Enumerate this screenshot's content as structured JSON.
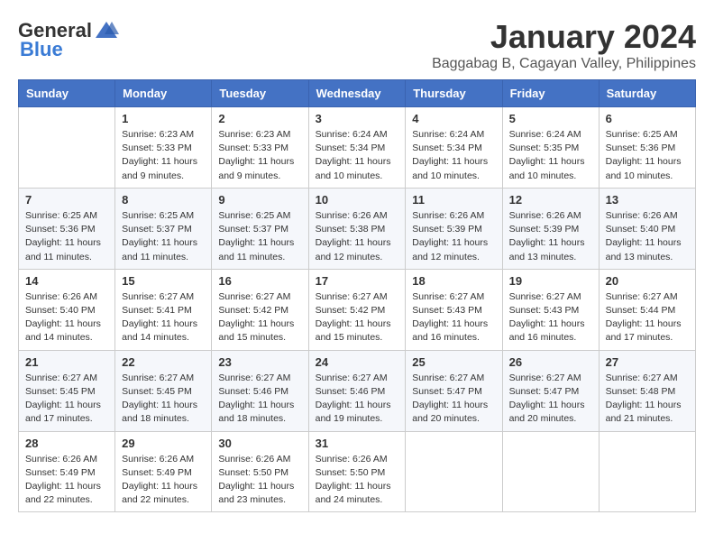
{
  "logo": {
    "general": "General",
    "blue": "Blue"
  },
  "header": {
    "month": "January 2024",
    "location": "Baggabag B, Cagayan Valley, Philippines"
  },
  "days_of_week": [
    "Sunday",
    "Monday",
    "Tuesday",
    "Wednesday",
    "Thursday",
    "Friday",
    "Saturday"
  ],
  "weeks": [
    [
      {
        "day": "",
        "sunrise": "",
        "sunset": "",
        "daylight": ""
      },
      {
        "day": "1",
        "sunrise": "Sunrise: 6:23 AM",
        "sunset": "Sunset: 5:33 PM",
        "daylight": "Daylight: 11 hours and 9 minutes."
      },
      {
        "day": "2",
        "sunrise": "Sunrise: 6:23 AM",
        "sunset": "Sunset: 5:33 PM",
        "daylight": "Daylight: 11 hours and 9 minutes."
      },
      {
        "day": "3",
        "sunrise": "Sunrise: 6:24 AM",
        "sunset": "Sunset: 5:34 PM",
        "daylight": "Daylight: 11 hours and 10 minutes."
      },
      {
        "day": "4",
        "sunrise": "Sunrise: 6:24 AM",
        "sunset": "Sunset: 5:34 PM",
        "daylight": "Daylight: 11 hours and 10 minutes."
      },
      {
        "day": "5",
        "sunrise": "Sunrise: 6:24 AM",
        "sunset": "Sunset: 5:35 PM",
        "daylight": "Daylight: 11 hours and 10 minutes."
      },
      {
        "day": "6",
        "sunrise": "Sunrise: 6:25 AM",
        "sunset": "Sunset: 5:36 PM",
        "daylight": "Daylight: 11 hours and 10 minutes."
      }
    ],
    [
      {
        "day": "7",
        "sunrise": "Sunrise: 6:25 AM",
        "sunset": "Sunset: 5:36 PM",
        "daylight": "Daylight: 11 hours and 11 minutes."
      },
      {
        "day": "8",
        "sunrise": "Sunrise: 6:25 AM",
        "sunset": "Sunset: 5:37 PM",
        "daylight": "Daylight: 11 hours and 11 minutes."
      },
      {
        "day": "9",
        "sunrise": "Sunrise: 6:25 AM",
        "sunset": "Sunset: 5:37 PM",
        "daylight": "Daylight: 11 hours and 11 minutes."
      },
      {
        "day": "10",
        "sunrise": "Sunrise: 6:26 AM",
        "sunset": "Sunset: 5:38 PM",
        "daylight": "Daylight: 11 hours and 12 minutes."
      },
      {
        "day": "11",
        "sunrise": "Sunrise: 6:26 AM",
        "sunset": "Sunset: 5:39 PM",
        "daylight": "Daylight: 11 hours and 12 minutes."
      },
      {
        "day": "12",
        "sunrise": "Sunrise: 6:26 AM",
        "sunset": "Sunset: 5:39 PM",
        "daylight": "Daylight: 11 hours and 13 minutes."
      },
      {
        "day": "13",
        "sunrise": "Sunrise: 6:26 AM",
        "sunset": "Sunset: 5:40 PM",
        "daylight": "Daylight: 11 hours and 13 minutes."
      }
    ],
    [
      {
        "day": "14",
        "sunrise": "Sunrise: 6:26 AM",
        "sunset": "Sunset: 5:40 PM",
        "daylight": "Daylight: 11 hours and 14 minutes."
      },
      {
        "day": "15",
        "sunrise": "Sunrise: 6:27 AM",
        "sunset": "Sunset: 5:41 PM",
        "daylight": "Daylight: 11 hours and 14 minutes."
      },
      {
        "day": "16",
        "sunrise": "Sunrise: 6:27 AM",
        "sunset": "Sunset: 5:42 PM",
        "daylight": "Daylight: 11 hours and 15 minutes."
      },
      {
        "day": "17",
        "sunrise": "Sunrise: 6:27 AM",
        "sunset": "Sunset: 5:42 PM",
        "daylight": "Daylight: 11 hours and 15 minutes."
      },
      {
        "day": "18",
        "sunrise": "Sunrise: 6:27 AM",
        "sunset": "Sunset: 5:43 PM",
        "daylight": "Daylight: 11 hours and 16 minutes."
      },
      {
        "day": "19",
        "sunrise": "Sunrise: 6:27 AM",
        "sunset": "Sunset: 5:43 PM",
        "daylight": "Daylight: 11 hours and 16 minutes."
      },
      {
        "day": "20",
        "sunrise": "Sunrise: 6:27 AM",
        "sunset": "Sunset: 5:44 PM",
        "daylight": "Daylight: 11 hours and 17 minutes."
      }
    ],
    [
      {
        "day": "21",
        "sunrise": "Sunrise: 6:27 AM",
        "sunset": "Sunset: 5:45 PM",
        "daylight": "Daylight: 11 hours and 17 minutes."
      },
      {
        "day": "22",
        "sunrise": "Sunrise: 6:27 AM",
        "sunset": "Sunset: 5:45 PM",
        "daylight": "Daylight: 11 hours and 18 minutes."
      },
      {
        "day": "23",
        "sunrise": "Sunrise: 6:27 AM",
        "sunset": "Sunset: 5:46 PM",
        "daylight": "Daylight: 11 hours and 18 minutes."
      },
      {
        "day": "24",
        "sunrise": "Sunrise: 6:27 AM",
        "sunset": "Sunset: 5:46 PM",
        "daylight": "Daylight: 11 hours and 19 minutes."
      },
      {
        "day": "25",
        "sunrise": "Sunrise: 6:27 AM",
        "sunset": "Sunset: 5:47 PM",
        "daylight": "Daylight: 11 hours and 20 minutes."
      },
      {
        "day": "26",
        "sunrise": "Sunrise: 6:27 AM",
        "sunset": "Sunset: 5:47 PM",
        "daylight": "Daylight: 11 hours and 20 minutes."
      },
      {
        "day": "27",
        "sunrise": "Sunrise: 6:27 AM",
        "sunset": "Sunset: 5:48 PM",
        "daylight": "Daylight: 11 hours and 21 minutes."
      }
    ],
    [
      {
        "day": "28",
        "sunrise": "Sunrise: 6:26 AM",
        "sunset": "Sunset: 5:49 PM",
        "daylight": "Daylight: 11 hours and 22 minutes."
      },
      {
        "day": "29",
        "sunrise": "Sunrise: 6:26 AM",
        "sunset": "Sunset: 5:49 PM",
        "daylight": "Daylight: 11 hours and 22 minutes."
      },
      {
        "day": "30",
        "sunrise": "Sunrise: 6:26 AM",
        "sunset": "Sunset: 5:50 PM",
        "daylight": "Daylight: 11 hours and 23 minutes."
      },
      {
        "day": "31",
        "sunrise": "Sunrise: 6:26 AM",
        "sunset": "Sunset: 5:50 PM",
        "daylight": "Daylight: 11 hours and 24 minutes."
      },
      {
        "day": "",
        "sunrise": "",
        "sunset": "",
        "daylight": ""
      },
      {
        "day": "",
        "sunrise": "",
        "sunset": "",
        "daylight": ""
      },
      {
        "day": "",
        "sunrise": "",
        "sunset": "",
        "daylight": ""
      }
    ]
  ]
}
